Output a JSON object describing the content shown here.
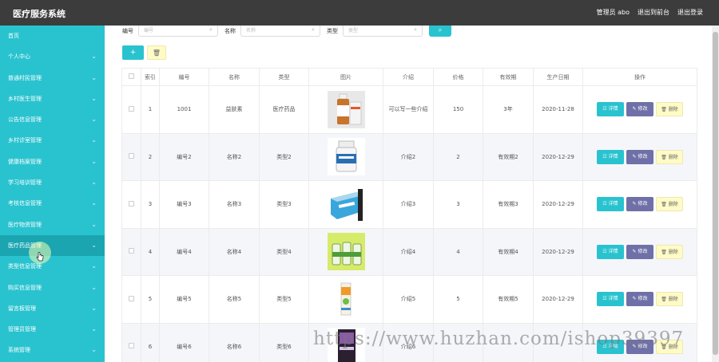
{
  "app": {
    "title": "医疗服务系统",
    "nav": [
      "管理员 abo",
      "退出到前台",
      "退出登录"
    ]
  },
  "sidebar": {
    "items": [
      {
        "label": "首页",
        "chevron": false
      },
      {
        "label": "个人中心",
        "chevron": true
      },
      {
        "label": "普通村民管理",
        "chevron": true
      },
      {
        "label": "乡村医生管理",
        "chevron": true
      },
      {
        "label": "公告信息管理",
        "chevron": true
      },
      {
        "label": "乡村诊室管理",
        "chevron": true
      },
      {
        "label": "健康档案管理",
        "chevron": true
      },
      {
        "label": "学习培训管理",
        "chevron": true
      },
      {
        "label": "考核信息管理",
        "chevron": true
      },
      {
        "label": "医疗物资管理",
        "chevron": true
      },
      {
        "label": "医疗药品管理",
        "chevron": true,
        "active": true
      },
      {
        "label": "类型信息管理",
        "chevron": true
      },
      {
        "label": "购买信息管理",
        "chevron": true
      },
      {
        "label": "留言板管理",
        "chevron": true
      },
      {
        "label": "管理员管理",
        "chevron": true
      },
      {
        "label": "系统管理",
        "chevron": true
      }
    ]
  },
  "search": {
    "fields": [
      {
        "label": "编号",
        "placeholder": "编号"
      },
      {
        "label": "名称",
        "placeholder": "名称"
      },
      {
        "label": "类型",
        "placeholder": "类型"
      }
    ],
    "button_icon": "search-icon"
  },
  "toolbar": {
    "add_label": "+",
    "delete_icon": "trash-icon"
  },
  "table": {
    "headers": [
      "索引",
      "编号",
      "名称",
      "类型",
      "图片",
      "介绍",
      "价格",
      "有效期",
      "生产日期",
      "操作"
    ],
    "rows": [
      {
        "index": "1",
        "code": "1001",
        "name": "益肤素",
        "type": "医疗药品",
        "intro": "可以写一些介绍",
        "price": "150",
        "validity": "3年",
        "date": "2020-11-28",
        "img": "orange-bottle"
      },
      {
        "index": "2",
        "code": "编号2",
        "name": "名称2",
        "type": "类型2",
        "intro": "介绍2",
        "price": "2",
        "validity": "有效期2",
        "date": "2020-12-29",
        "img": "white-bottle"
      },
      {
        "index": "3",
        "code": "编号3",
        "name": "名称3",
        "type": "类型3",
        "intro": "介绍3",
        "price": "3",
        "validity": "有效期3",
        "date": "2020-12-29",
        "img": "blue-box"
      },
      {
        "index": "4",
        "code": "编号4",
        "name": "名称4",
        "type": "类型4",
        "intro": "介绍4",
        "price": "4",
        "validity": "有效期4",
        "date": "2020-12-29",
        "img": "green-bottles"
      },
      {
        "index": "5",
        "code": "编号5",
        "name": "名称5",
        "type": "类型5",
        "intro": "介绍5",
        "price": "5",
        "validity": "有效期5",
        "date": "2020-12-29",
        "img": "orange-tube"
      },
      {
        "index": "6",
        "code": "编号6",
        "name": "名称6",
        "type": "类型6",
        "intro": "介绍6",
        "price": "",
        "validity": "",
        "date": "",
        "img": "purple-box"
      }
    ],
    "ops": {
      "detail": "详情",
      "edit": "修改",
      "delete": "删除"
    }
  },
  "watermark": "https://www.huzhan.com/ishop39397",
  "colors": {
    "accent": "#29c3cf",
    "topbar": "#3c3c3c",
    "edit": "#7070a8",
    "delete": "#fffbc6"
  }
}
